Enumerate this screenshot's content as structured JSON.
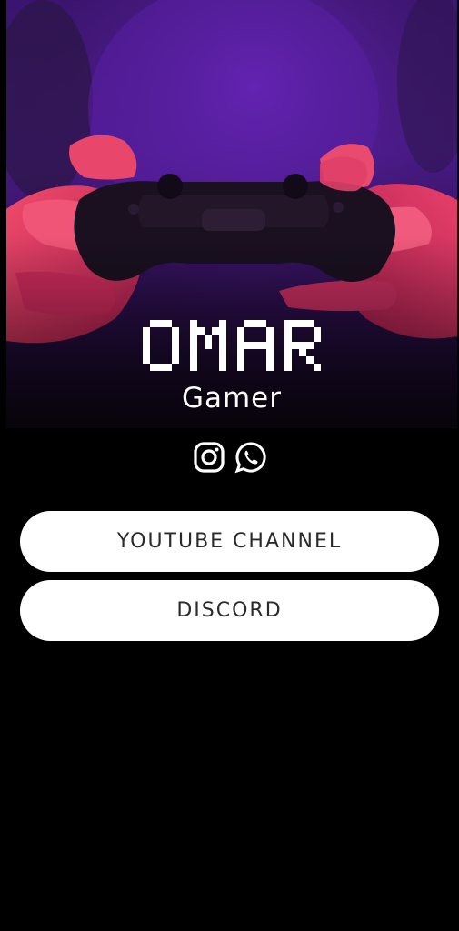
{
  "profile": {
    "name": "OMAR",
    "tagline": "Gamer"
  },
  "socials": [
    {
      "icon": "instagram-icon"
    },
    {
      "icon": "whatsapp-icon"
    }
  ],
  "links": [
    {
      "label": "YOUTUBE CHANNEL"
    },
    {
      "label": "DISCORD"
    }
  ],
  "colors": {
    "page_background": "#000000",
    "button_background": "#ffffff",
    "button_text": "#2b2b2b",
    "hero_purple": "#5b1d9c",
    "hero_pink": "#e0305a"
  }
}
